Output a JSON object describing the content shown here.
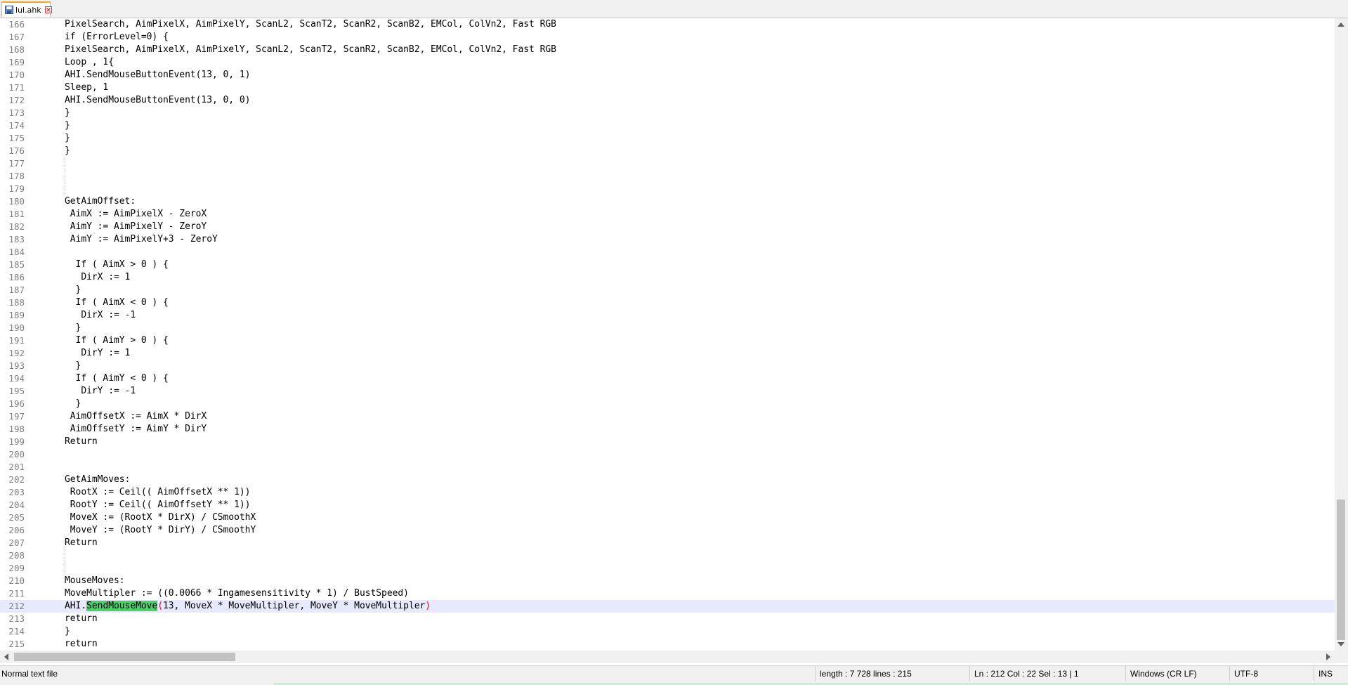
{
  "tab": {
    "label": "lul.ahk"
  },
  "status": {
    "file_type": "Normal text file",
    "length_lines": "length : 7 728    lines : 215",
    "position": "Ln : 212    Col : 22    Sel : 13 | 1",
    "eol": "Windows (CR LF)",
    "encoding": "UTF-8",
    "mode": "INS"
  },
  "editor": {
    "current_line": 212,
    "lines": [
      {
        "n": "166",
        "t": "PixelSearch, AimPixelX, AimPixelY, ScanL2, ScanT2, ScanR2, ScanB2, EMCol, ColVn2, Fast RGB"
      },
      {
        "n": "167",
        "t": "if (ErrorLevel=0) {"
      },
      {
        "n": "168",
        "t": "PixelSearch, AimPixelX, AimPixelY, ScanL2, ScanT2, ScanR2, ScanB2, EMCol, ColVn2, Fast RGB"
      },
      {
        "n": "169",
        "t": "Loop , 1{"
      },
      {
        "n": "170",
        "t": "AHI.SendMouseButtonEvent(13, 0, 1)"
      },
      {
        "n": "171",
        "t": "Sleep, 1"
      },
      {
        "n": "172",
        "t": "AHI.SendMouseButtonEvent(13, 0, 0)"
      },
      {
        "n": "173",
        "t": "}"
      },
      {
        "n": "174",
        "t": "}"
      },
      {
        "n": "175",
        "t": "}"
      },
      {
        "n": "176",
        "t": "}"
      },
      {
        "n": "177",
        "t": ""
      },
      {
        "n": "178",
        "t": ""
      },
      {
        "n": "179",
        "t": ""
      },
      {
        "n": "180",
        "t": "GetAimOffset:"
      },
      {
        "n": "181",
        "t": " AimX := AimPixelX - ZeroX"
      },
      {
        "n": "182",
        "t": " AimY := AimPixelY - ZeroY"
      },
      {
        "n": "183",
        "t": " AimY := AimPixelY+3 - ZeroY"
      },
      {
        "n": "184",
        "t": ""
      },
      {
        "n": "185",
        "t": "  If ( AimX > 0 ) {"
      },
      {
        "n": "186",
        "t": "   DirX := 1"
      },
      {
        "n": "187",
        "t": "  }"
      },
      {
        "n": "188",
        "t": "  If ( AimX < 0 ) {"
      },
      {
        "n": "189",
        "t": "   DirX := -1"
      },
      {
        "n": "190",
        "t": "  }"
      },
      {
        "n": "191",
        "t": "  If ( AimY > 0 ) {"
      },
      {
        "n": "192",
        "t": "   DirY := 1"
      },
      {
        "n": "193",
        "t": "  }"
      },
      {
        "n": "194",
        "t": "  If ( AimY < 0 ) {"
      },
      {
        "n": "195",
        "t": "   DirY := -1"
      },
      {
        "n": "196",
        "t": "  }"
      },
      {
        "n": "197",
        "t": " AimOffsetX := AimX * DirX"
      },
      {
        "n": "198",
        "t": " AimOffsetY := AimY * DirY"
      },
      {
        "n": "199",
        "t": "Return"
      },
      {
        "n": "200",
        "t": ""
      },
      {
        "n": "201",
        "t": ""
      },
      {
        "n": "202",
        "t": "GetAimMoves:"
      },
      {
        "n": "203",
        "t": " RootX := Ceil(( AimOffsetX ** 1))"
      },
      {
        "n": "204",
        "t": " RootY := Ceil(( AimOffsetY ** 1))"
      },
      {
        "n": "205",
        "t": " MoveX := (RootX * DirX) / CSmoothX"
      },
      {
        "n": "206",
        "t": " MoveY := (RootY * DirY) / CSmoothY"
      },
      {
        "n": "207",
        "t": "Return"
      },
      {
        "n": "208",
        "t": ""
      },
      {
        "n": "209",
        "t": ""
      },
      {
        "n": "210",
        "t": "MouseMoves:"
      },
      {
        "n": "211",
        "t": "MoveMultipler := ((0.0066 * Ingamesensitivity * 1) / BustSpeed)"
      },
      {
        "n": "212",
        "t": "AHI.SendMouseMove(13, MoveX * MoveMultipler, MoveY * MoveMultipler)",
        "hl_pre": "AHI.",
        "hl_word": "SendMouseMove",
        "hl_paren": "(",
        "hl_mid": "13, MoveX * MoveMultipler, MoveY * MoveMultipler",
        "hl_close": ")"
      },
      {
        "n": "213",
        "t": "return"
      },
      {
        "n": "214",
        "t": "}"
      },
      {
        "n": "215",
        "t": "return"
      }
    ]
  },
  "colors": {
    "current_line": "#e8e8ff",
    "match_highlight": "#4fd06c",
    "brace_match": "#ff0000",
    "line_number": "#808080"
  }
}
